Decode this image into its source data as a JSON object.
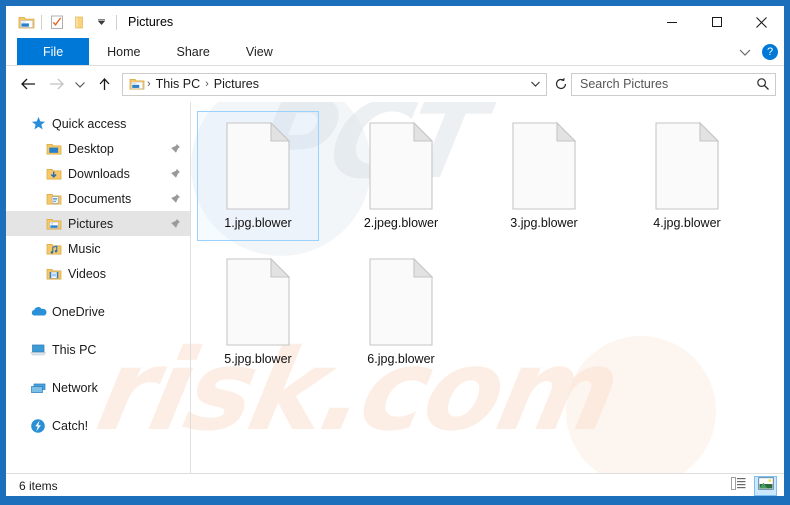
{
  "window": {
    "title": "Pictures",
    "quick_access_icons": [
      "explorer-icon",
      "properties-icon",
      "new-folder-icon",
      "customize-chevron-icon"
    ],
    "controls": {
      "minimize": "minimize-icon",
      "maximize": "maximize-icon",
      "close": "close-icon"
    },
    "frame_color": "#1c6fba"
  },
  "ribbon": {
    "tabs": [
      {
        "label": "File",
        "active": true
      },
      {
        "label": "Home",
        "active": false
      },
      {
        "label": "Share",
        "active": false
      },
      {
        "label": "View",
        "active": false
      }
    ],
    "collapse_icon": "chevron-down-icon",
    "help_label": "?",
    "accent_color": "#0078d7"
  },
  "address_bar": {
    "back_label": "Back",
    "forward_label": "Forward",
    "recent_label": "Recent locations",
    "up_label": "Up one level",
    "breadcrumb": [
      "This PC",
      "Pictures"
    ],
    "breadcrumb_separator": "›",
    "dropdown_icon": "chevron-down-icon",
    "refresh_icon": "refresh-icon"
  },
  "search": {
    "placeholder": "Search Pictures",
    "icon": "search-icon"
  },
  "sidebar": {
    "groups": [
      {
        "header": {
          "label": "Quick access",
          "icon": "star-icon"
        },
        "items": [
          {
            "label": "Desktop",
            "icon": "folder-desktop-icon",
            "pinned": true,
            "selected": false
          },
          {
            "label": "Downloads",
            "icon": "folder-downloads-icon",
            "pinned": true,
            "selected": false
          },
          {
            "label": "Documents",
            "icon": "folder-documents-icon",
            "pinned": true,
            "selected": false
          },
          {
            "label": "Pictures",
            "icon": "folder-pictures-icon",
            "pinned": true,
            "selected": true
          },
          {
            "label": "Music",
            "icon": "folder-music-icon",
            "pinned": false,
            "selected": false
          },
          {
            "label": "Videos",
            "icon": "folder-videos-icon",
            "pinned": false,
            "selected": false
          }
        ]
      },
      {
        "header": null,
        "items": [
          {
            "label": "OneDrive",
            "icon": "onedrive-cloud-icon",
            "pinned": false,
            "selected": false
          }
        ]
      },
      {
        "header": null,
        "items": [
          {
            "label": "This PC",
            "icon": "this-pc-icon",
            "pinned": false,
            "selected": false
          }
        ]
      },
      {
        "header": null,
        "items": [
          {
            "label": "Network",
            "icon": "network-icon",
            "pinned": false,
            "selected": false
          }
        ]
      },
      {
        "header": null,
        "items": [
          {
            "label": "Catch!",
            "icon": "catch-icon",
            "pinned": false,
            "selected": false
          }
        ]
      }
    ]
  },
  "files": [
    {
      "name": "1.jpg.blower",
      "icon": "blank-document-icon",
      "selected": true
    },
    {
      "name": "2.jpeg.blower",
      "icon": "blank-document-icon",
      "selected": false
    },
    {
      "name": "3.jpg.blower",
      "icon": "blank-document-icon",
      "selected": false
    },
    {
      "name": "4.jpg.blower",
      "icon": "blank-document-icon",
      "selected": false
    },
    {
      "name": "5.jpg.blower",
      "icon": "blank-document-icon",
      "selected": false
    },
    {
      "name": "6.jpg.blower",
      "icon": "blank-document-icon",
      "selected": false
    }
  ],
  "status": {
    "item_count": "6 items",
    "views": [
      {
        "name": "details-view",
        "icon": "details-view-icon",
        "active": false
      },
      {
        "name": "large-icons-view",
        "icon": "large-icons-view-icon",
        "active": true
      }
    ]
  },
  "watermark": {
    "top_text": "PCT",
    "bottom_text": "risk.com"
  }
}
